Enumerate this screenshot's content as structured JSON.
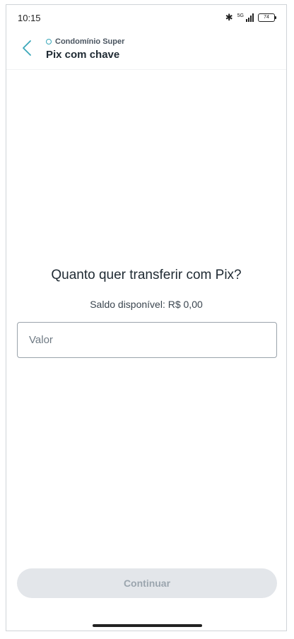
{
  "status_bar": {
    "time": "10:15",
    "network_label": "5G",
    "battery_level": "74",
    "icons": [
      "bluetooth-icon",
      "signal-icon",
      "battery-icon"
    ]
  },
  "header": {
    "context_label": "Condomínio Super",
    "title": "Pix com chave",
    "back_icon": "chevron-left-icon"
  },
  "main": {
    "question": "Quanto quer transferir com Pix?",
    "balance_text": "Saldo disponível: R$ 0,00",
    "amount_input": {
      "value": "",
      "placeholder": "Valor"
    }
  },
  "footer": {
    "continue_label": "Continuar",
    "continue_enabled": false
  },
  "colors": {
    "accent": "#3aa7b9",
    "text_primary": "#1f2a33",
    "button_disabled_bg": "#e3e6ea",
    "button_disabled_text": "#9ba5ae"
  }
}
